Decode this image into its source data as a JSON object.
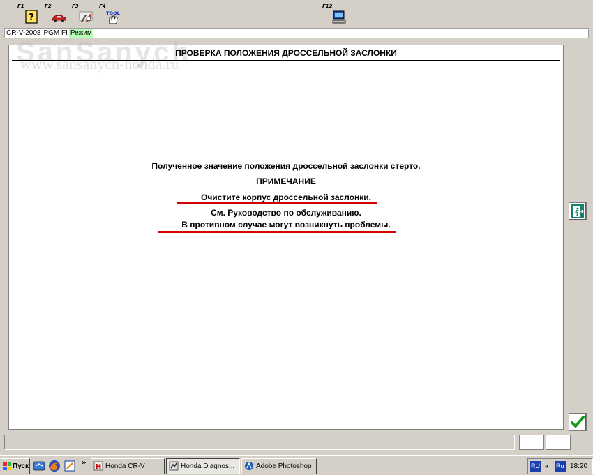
{
  "toolbar": {
    "buttons": [
      {
        "key": "F1",
        "icon": "help-icon"
      },
      {
        "key": "F2",
        "icon": "car-icon"
      },
      {
        "key": "F3",
        "icon": "tools-icon"
      },
      {
        "key": "F4",
        "icon": "tool-hand-icon",
        "icon_text": "TOOL"
      },
      {
        "key": "F12",
        "icon": "computer-icon"
      }
    ]
  },
  "info": {
    "model": "CR-V-2008",
    "system": "PGM FI",
    "mode": "Режим"
  },
  "watermark": {
    "line1": "SanSanych",
    "line2": "www.sansanych-honda.ru"
  },
  "screen": {
    "title": "ПРОВЕРКА ПОЛОЖЕНИЯ ДРОССЕЛЬНОЙ ЗАСЛОНКИ",
    "message": "Полученное значение положения дроссельной заслонки стерто.",
    "note_heading": "ПРИМЕЧАНИЕ",
    "note_line1": "Очистите корпус дроссельной заслонки.",
    "note_line2": "См. Руководство по обслуживанию.",
    "note_line3": "В противном случае могут возникнуть проблемы."
  },
  "side": {
    "exit_icon": "exit-door-icon",
    "ok_icon": "checkmark-icon"
  },
  "colors": {
    "underline": "#d40000",
    "mode_bg": "#b7ffb7",
    "check": "#1a9a1a"
  },
  "taskbar": {
    "start_label": "Пуск",
    "quicklaunch": [
      "desktop-icon",
      "firefox-icon",
      "notepad-icon"
    ],
    "chevron": "»",
    "tasks": [
      {
        "label": "Honda CR-V",
        "active": false
      },
      {
        "label": "Honda Diagnos...",
        "active": true
      },
      {
        "label": "Adobe Photoshop",
        "active": false
      }
    ],
    "lang1": "RU",
    "lang_toggle": "«",
    "lang2": "Ru",
    "clock": "18:20"
  }
}
